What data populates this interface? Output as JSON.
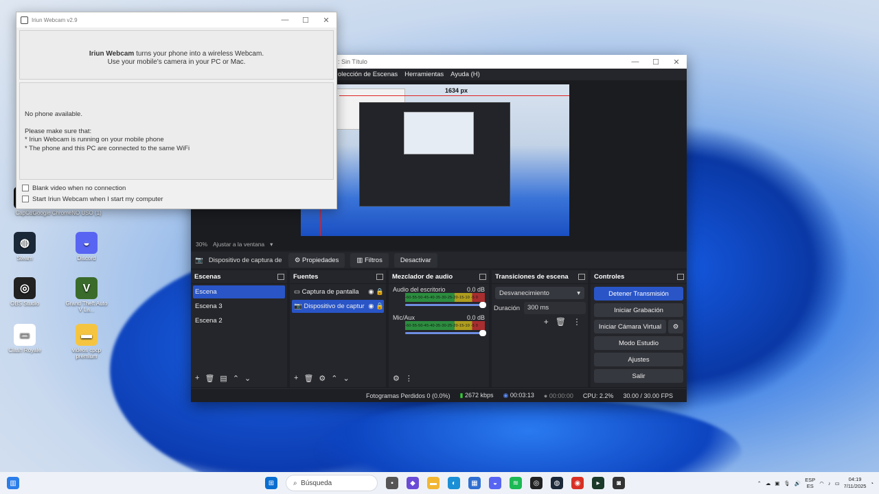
{
  "desktop": {
    "icons": [
      {
        "label": "CapCut",
        "color": "#111111",
        "glyph": "S"
      },
      {
        "label": "Google Chrome",
        "color": "#d93025",
        "glyph": "◉"
      },
      {
        "label": "NO USO (1)",
        "color": "#444444",
        "glyph": "▣"
      },
      {
        "label": "Steam",
        "color": "#1b2838",
        "glyph": "◍"
      },
      {
        "label": "Discord",
        "color": "#5865f2",
        "glyph": "◒"
      },
      {
        "label": "OBS Studio",
        "color": "#222222",
        "glyph": "◎"
      },
      {
        "label": "Grand Theft Auto V La...",
        "color": "#3a6b2a",
        "glyph": "V"
      },
      {
        "label": "Clash Royale",
        "color": "#ffffff",
        "glyph": "▭"
      },
      {
        "label": "videos cpcp premium",
        "color": "#f5c542",
        "glyph": "▬"
      }
    ]
  },
  "iriun": {
    "title": "Iriun Webcam v2.9",
    "header_bold": "Iriun Webcam",
    "header_text": " turns your phone into a wireless Webcam.",
    "header_line2": "Use your mobile's camera in your PC or Mac.",
    "status": "No phone available.",
    "hint_title": "Please make sure that:",
    "hint_1": "* Iriun Webcam is running on your mobile phone",
    "hint_2": "* The phone and this PC are connected to the same WiFi",
    "check_blank": "Blank video when no connection",
    "check_start": "Start Iriun Webcam when I start my computer"
  },
  "obs": {
    "title": ": Sin Título",
    "menu": [
      "olección de Escenas",
      "Herramientas",
      "Ayuda (H)"
    ],
    "preview_px": "1634 px",
    "zoom": "30%",
    "zoom_mode": "Ajustar a la ventana",
    "source_name": "Dispositivo de captura de v",
    "btn_props": "Propiedades",
    "btn_filters": "Filtros",
    "btn_deactivate": "Desactivar",
    "scenes": {
      "title": "Escenas",
      "items": [
        "Escena",
        "Escena 3",
        "Escena 2"
      ]
    },
    "sources": {
      "title": "Fuentes",
      "items": [
        "Captura de pantalla",
        "Dispositivo de captur"
      ]
    },
    "mixer": {
      "title": "Mezclador de audio",
      "tracks": [
        {
          "name": "Audio del escritorio",
          "db": "0.0 dB"
        },
        {
          "name": "Mic/Aux",
          "db": "0.0 dB"
        }
      ],
      "scale": "-60-55-50-45-40-35-30-25-20-15-10 -5  0"
    },
    "transitions": {
      "title": "Transiciones de escena",
      "selected": "Desvanecimiento",
      "duration_label": "Duración",
      "duration_value": "300 ms"
    },
    "controls": {
      "title": "Controles",
      "buttons": [
        "Detener Transmisión",
        "Iniciar Grabación",
        "Iniciar Cámara Virtual",
        "Modo Estudio",
        "Ajustes",
        "Salir"
      ]
    },
    "status": {
      "dropped": "Fotogramas Perdidos 0 (0.0%)",
      "bitrate": "2672 kbps",
      "stream_time": "00:03:13",
      "rec_time": "00:00:00",
      "cpu": "CPU: 2.2%",
      "fps": "30.00 / 30.00 FPS"
    }
  },
  "taskbar": {
    "search_placeholder": "Búsqueda",
    "lang_top": "ESP",
    "lang_bottom": "ES",
    "time": "04:19",
    "date": "7/11/2025",
    "apps": [
      {
        "name": "files",
        "color": "#555555",
        "glyph": "▪"
      },
      {
        "name": "copilot",
        "color": "#6a4bd6",
        "glyph": "◆"
      },
      {
        "name": "explorer",
        "color": "#f2b632",
        "glyph": "▬"
      },
      {
        "name": "edge",
        "color": "#1a8fd6",
        "glyph": "◐"
      },
      {
        "name": "store",
        "color": "#2f6fd1",
        "glyph": "▦"
      },
      {
        "name": "discord",
        "color": "#5865f2",
        "glyph": "◒"
      },
      {
        "name": "spotify",
        "color": "#1db954",
        "glyph": "≋"
      },
      {
        "name": "obs",
        "color": "#222222",
        "glyph": "◎"
      },
      {
        "name": "steam",
        "color": "#1b2838",
        "glyph": "◍"
      },
      {
        "name": "chrome",
        "color": "#d93025",
        "glyph": "◉"
      },
      {
        "name": "terminal",
        "color": "#1b3a2a",
        "glyph": "▸"
      },
      {
        "name": "iriun",
        "color": "#333333",
        "glyph": "◙"
      }
    ]
  }
}
